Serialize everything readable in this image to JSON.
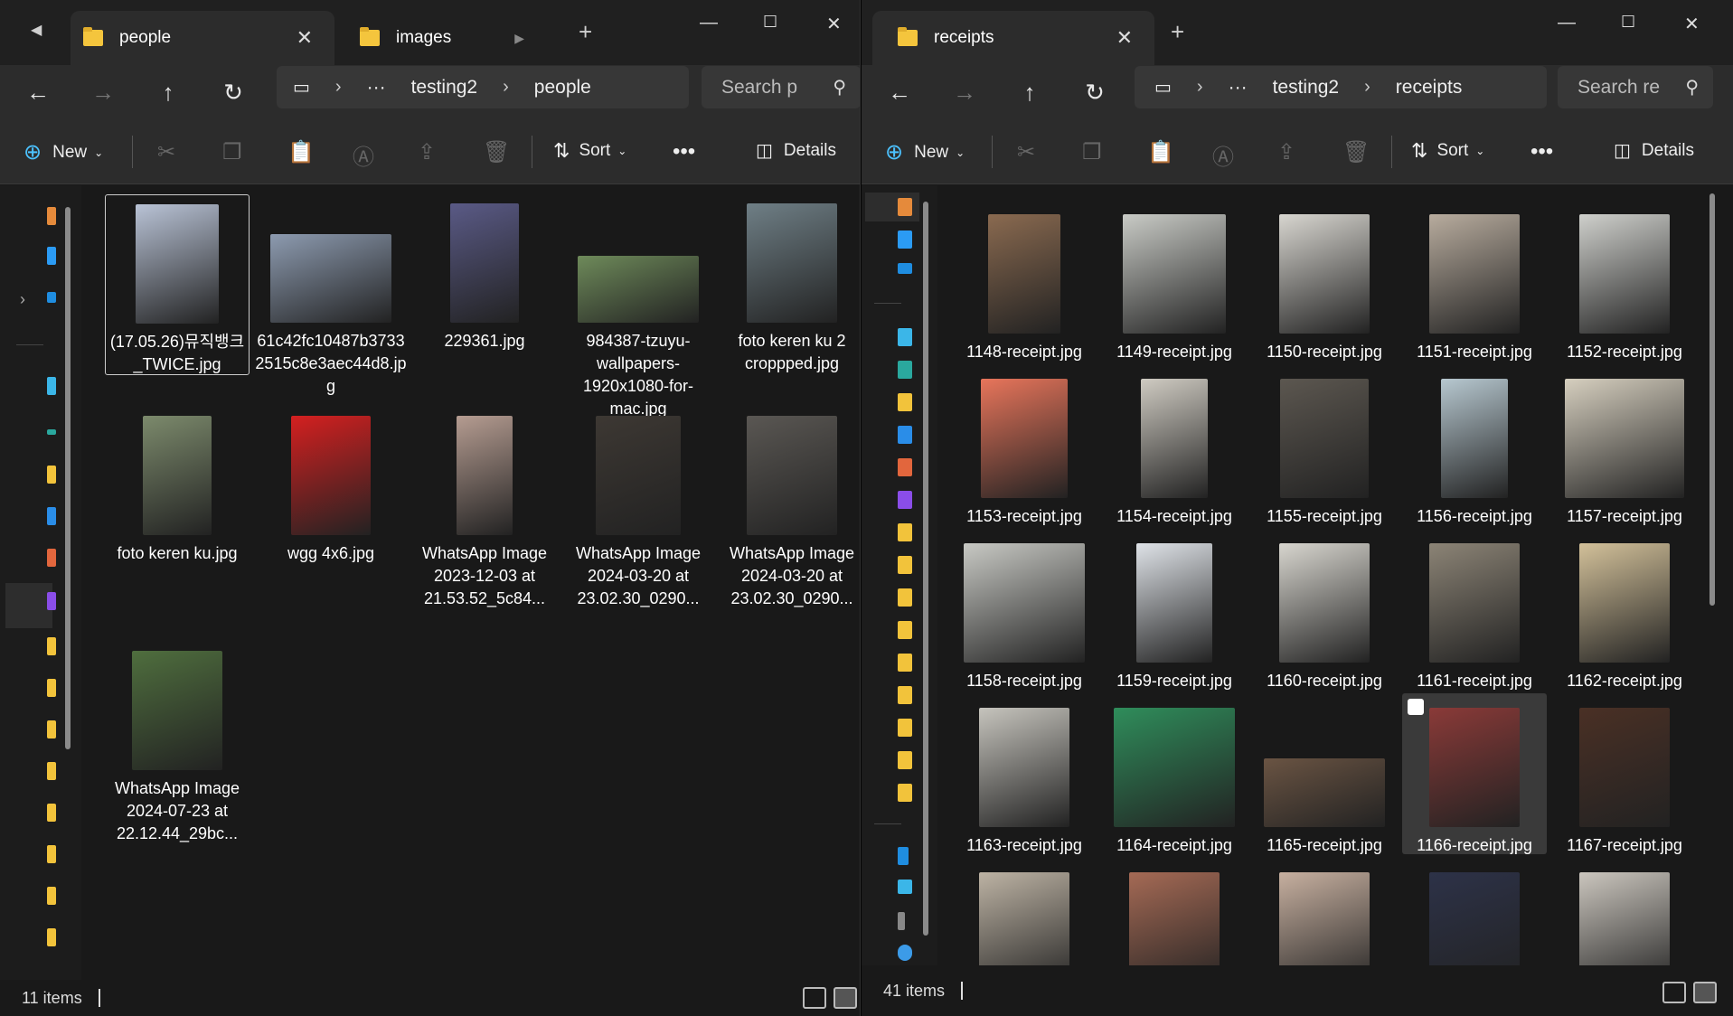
{
  "left": {
    "tabs": [
      {
        "label": "people"
      },
      {
        "label": "images"
      }
    ],
    "breadcrumb": [
      "testing2",
      "people"
    ],
    "search_placeholder": "Search p",
    "toolbar": {
      "new": "New",
      "sort": "Sort",
      "details": "Details"
    },
    "items": [
      {
        "name": "(17.05.26)뮤직뱅크_TWICE.jpg",
        "color": "#b9c3d6"
      },
      {
        "name": "61c42fc10487b37332515c8e3aec44d8.jpg",
        "color": "#8d9bb0"
      },
      {
        "name": "229361.jpg",
        "color": "#5a5a86"
      },
      {
        "name": "984387-tzuyu-wallpapers-1920x1080-for-mac.jpg",
        "color": "#6e8a5a"
      },
      {
        "name": "foto keren ku 2 croppped.jpg",
        "color": "#6f7f86"
      },
      {
        "name": "foto keren ku.jpg",
        "color": "#7c8a6c"
      },
      {
        "name": "wgg 4x6.jpg",
        "color": "#d42020"
      },
      {
        "name": "WhatsApp Image 2023-12-03 at 21.53.52_5c84...",
        "color": "#b59c91"
      },
      {
        "name": "WhatsApp Image 2024-03-20 at 23.02.30_0290...",
        "color": "#3d3833"
      },
      {
        "name": "WhatsApp Image 2024-03-20 at 23.02.30_0290...",
        "color": "#5a5753"
      },
      {
        "name": "WhatsApp Image 2024-07-23 at 22.12.44_29bc...",
        "color": "#4f6e3e"
      }
    ],
    "status": "11 items"
  },
  "right": {
    "tabs": [
      {
        "label": "receipts"
      }
    ],
    "breadcrumb": [
      "testing2",
      "receipts"
    ],
    "search_placeholder": "Search re",
    "toolbar": {
      "new": "New",
      "sort": "Sort",
      "details": "Details"
    },
    "items": [
      {
        "name": "1148-receipt.jpg",
        "color": "#8a6a50"
      },
      {
        "name": "1149-receipt.jpg",
        "color": "#c9cbc6"
      },
      {
        "name": "1150-receipt.jpg",
        "color": "#d8d6d0"
      },
      {
        "name": "1151-receipt.jpg",
        "color": "#b8ac9e"
      },
      {
        "name": "1152-receipt.jpg",
        "color": "#cfd0cc"
      },
      {
        "name": "1153-receipt.jpg",
        "color": "#e8755b"
      },
      {
        "name": "1154-receipt.jpg",
        "color": "#cfcbc2"
      },
      {
        "name": "1155-receipt.jpg",
        "color": "#5c5750"
      },
      {
        "name": "1156-receipt.jpg",
        "color": "#b7c8d0"
      },
      {
        "name": "1157-receipt.jpg",
        "color": "#d6cfbf"
      },
      {
        "name": "1158-receipt.jpg",
        "color": "#c8c9c4"
      },
      {
        "name": "1159-receipt.jpg",
        "color": "#dfe3e8"
      },
      {
        "name": "1160-receipt.jpg",
        "color": "#d8d6cf"
      },
      {
        "name": "1161-receipt.jpg",
        "color": "#8c8476"
      },
      {
        "name": "1162-receipt.jpg",
        "color": "#d3c19a"
      },
      {
        "name": "1163-receipt.jpg",
        "color": "#c6c4bd"
      },
      {
        "name": "1164-receipt.jpg",
        "color": "#2f8d5b"
      },
      {
        "name": "1165-receipt.jpg",
        "color": "#6a5443"
      },
      {
        "name": "1166-receipt.jpg",
        "color": "#8a3a38"
      },
      {
        "name": "1167-receipt.jpg",
        "color": "#4a3025"
      },
      {
        "name": "",
        "color": "#bdb3a4"
      },
      {
        "name": "",
        "color": "#a56a55"
      },
      {
        "name": "",
        "color": "#c7b0a0"
      },
      {
        "name": "",
        "color": "#2d3248"
      },
      {
        "name": "",
        "color": "#cbc6be"
      }
    ],
    "status": "41 items"
  }
}
